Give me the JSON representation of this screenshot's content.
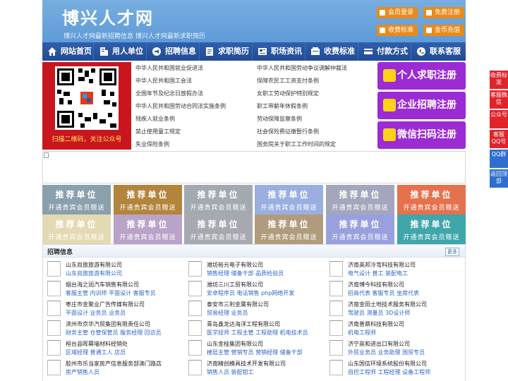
{
  "header": {
    "logo": "博兴人才网",
    "tagline": "博兴人才网最新招聘信息   博兴人才网最新求职简历",
    "buttons": [
      {
        "label": "会员登录",
        "icon": "user-icon"
      },
      {
        "label": "免费注册",
        "icon": "register-icon"
      },
      {
        "label": "收费标准",
        "icon": "price-icon"
      },
      {
        "label": "金币充值",
        "icon": "coin-icon"
      }
    ]
  },
  "nav": [
    {
      "label": "网站首页",
      "icon": "home-icon"
    },
    {
      "label": "用人单位",
      "icon": "building-icon"
    },
    {
      "label": "招聘信息",
      "icon": "megaphone-icon"
    },
    {
      "label": "求职简历",
      "icon": "resume-icon"
    },
    {
      "label": "职场资讯",
      "icon": "news-icon"
    },
    {
      "label": "收费标准",
      "icon": "price-icon"
    },
    {
      "label": "付款方式",
      "icon": "payment-icon"
    },
    {
      "label": "联系客服",
      "icon": "phone-icon"
    }
  ],
  "qr": {
    "caption": "扫描二维码，关注公众号"
  },
  "laws_left": [
    "中华人民共和国就业促进法",
    "中华人民共和国工会法",
    "全国年节及纪念日放假办法",
    "中华人民共和国劳动合同法实施条例",
    "残疾人就业条例",
    "禁止使用童工规定",
    "失业保险条例"
  ],
  "laws_right": [
    "中华人民共和国劳动争议调解仲裁法",
    "保障农民工工资支付条例",
    "女职工劳动保护特别规定",
    "职工带薪年休假条例",
    "劳动保障监察条例",
    "社会保险费征缴暂行条例",
    "国务院关于职工工作时间的规定"
  ],
  "register": [
    {
      "label": "个人求职注册",
      "icon": "person-icon"
    },
    {
      "label": "企业招聘注册",
      "icon": "company-icon"
    },
    {
      "label": "微信扫码注册",
      "icon": "wechat-icon"
    }
  ],
  "tiles": {
    "title": "推荐单位",
    "subtitle": "开通贵宾会员赠送",
    "colors": [
      "#8aa0ac",
      "#b2843c",
      "#a3a9b0",
      "#9aaee0",
      "#a3a6bc",
      "#e4724c",
      "#e3d9b3",
      "#b9a3c9",
      "#a6a9b0",
      "#b09c7c",
      "#99a0dd",
      "#3fa6a9"
    ]
  },
  "jobs": {
    "title": "招聘信息",
    "more": "更多",
    "items": [
      {
        "company": "山东尚旅旅游有限公司",
        "positions": "山东尚旅旅游有限公司"
      },
      {
        "company": "潍坊裕元电子有限公司",
        "positions": "销售经理 储备干部 品质检验员"
      },
      {
        "company": "济南英邦冷弯科技有限公司",
        "positions": "电气设计 普工 装配电工"
      },
      {
        "company": "烟台海之润汽车销售有限公司",
        "positions": "客服主管 内训师 平面设计 客服专员"
      },
      {
        "company": "潍坊三川工贸有限公司",
        "positions": "安卓程序员 电话销售 php网络开发"
      },
      {
        "company": "济南博今科技有限公司",
        "positions": "招商代表 客服专员 坐席代表"
      },
      {
        "company": "枣庄市金聚业广告传媒有限公司",
        "positions": "平面设计 业务员 业务员"
      },
      {
        "company": "泰安市三利金属有限公司",
        "positions": "贸易经理 业务员"
      },
      {
        "company": "济南金田土地技术服务有限公司",
        "positions": "驾驶员 测量员 3D设计师"
      },
      {
        "company": "滨州市京华汽贸集团有限责任公司",
        "positions": "财务主管 仓管保管员 服务经理 回访员"
      },
      {
        "company": "青岛鑫龙达海洋工程有限公司",
        "positions": "医学技师 工程主管 工程助理 机电技术员"
      },
      {
        "company": "济南普鼎科技有限公司",
        "positions": "机电工程师"
      },
      {
        "company": "桓台县晖幕墙材料经销处",
        "positions": "区域经理 普通工人 店员"
      },
      {
        "company": "山东金桂集团有限公司",
        "positions": "楼层主管 营销专员 营销经理 储备干部"
      },
      {
        "company": "济宁英和进出口有限公司",
        "positions": "外贸业务员 业务助理 国贸专员"
      },
      {
        "company": "胶州市乐当家房产信息服务部澳门路店",
        "positions": "房产销售人员"
      },
      {
        "company": "济南精创模具技术开发有限公司",
        "positions": "销售人员 装配钳工"
      },
      {
        "company": "山东国信环境系统股份有限公司",
        "positions": "自控工程师 工程经理 设备工程师"
      }
    ]
  },
  "side": [
    {
      "label": "收费标准",
      "color": "red"
    },
    {
      "label": "客服微信",
      "color": "red"
    },
    {
      "label": "公众号",
      "color": "red"
    },
    {
      "label": "客服QQ号",
      "color": "red"
    },
    {
      "label": "QQ群",
      "color": "blue"
    },
    {
      "label": "返回顶部",
      "color": "blue"
    }
  ]
}
